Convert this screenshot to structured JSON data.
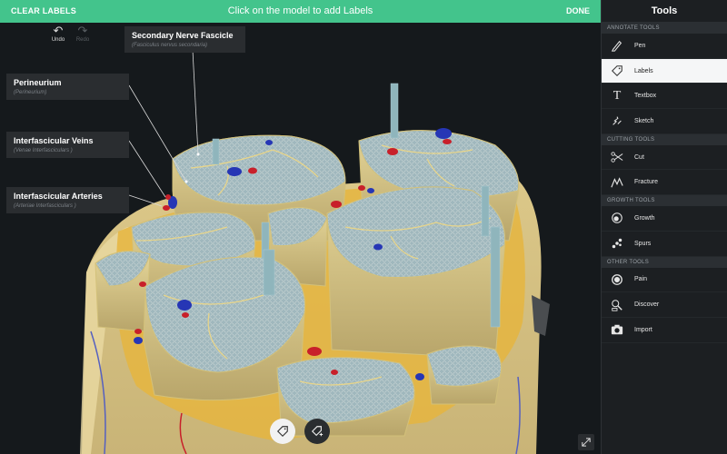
{
  "topbar": {
    "clear_label": "CLEAR LABELS",
    "instruction": "Click on the model to add Labels",
    "done_label": "DONE"
  },
  "history": {
    "undo_label": "Undo",
    "redo_label": "Redo"
  },
  "labels": [
    {
      "name": "Secondary Nerve Fascicle",
      "latin": "(Fasciculus nervus secondaria)"
    },
    {
      "name": "Perineurium",
      "latin": "(Perineurium)"
    },
    {
      "name": "Interfascicular Veins",
      "latin": "(Venae Interfasciculars )"
    },
    {
      "name": "Interfascicular Arteries",
      "latin": "(Arteriae Interfasciculars )"
    }
  ],
  "sidebar": {
    "title": "Tools",
    "sections": [
      {
        "title": "ANNOTATE TOOLS",
        "items": [
          {
            "label": "Pen",
            "icon": "pen-icon"
          },
          {
            "label": "Labels",
            "icon": "label-tag-icon",
            "active": true
          },
          {
            "label": "Textbox",
            "icon": "textbox-icon"
          },
          {
            "label": "Sketch",
            "icon": "sketch-icon"
          }
        ]
      },
      {
        "title": "CUTTING TOOLS",
        "items": [
          {
            "label": "Cut",
            "icon": "scissors-icon"
          },
          {
            "label": "Fracture",
            "icon": "fracture-icon"
          }
        ]
      },
      {
        "title": "GROWTH TOOLS",
        "items": [
          {
            "label": "Growth",
            "icon": "growth-icon"
          },
          {
            "label": "Spurs",
            "icon": "spurs-icon"
          }
        ]
      },
      {
        "title": "OTHER TOOLS",
        "items": [
          {
            "label": "Pain",
            "icon": "pain-icon"
          },
          {
            "label": "Discover",
            "icon": "discover-icon"
          },
          {
            "label": "Import",
            "icon": "camera-icon"
          }
        ]
      }
    ]
  },
  "colors": {
    "accent": "#43c48c",
    "sidebar_bg": "#1c1f22",
    "viewport_bg": "#15191c",
    "label_bg": "#2a2d30",
    "nerve_tissue": "#d9cf94",
    "fascicle_fill": "#a9bcc0",
    "artery": "#c8202a",
    "vein": "#2636b5"
  }
}
